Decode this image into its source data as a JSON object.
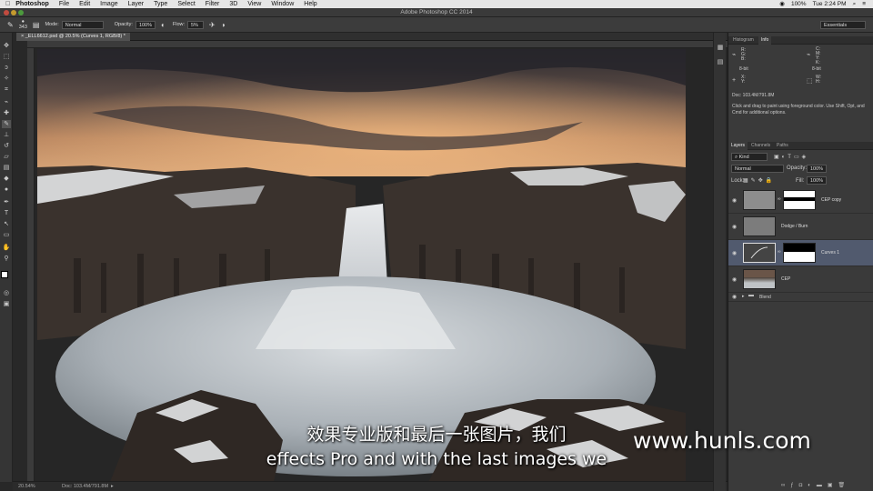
{
  "menubar": {
    "app": "Photoshop",
    "items": [
      "File",
      "Edit",
      "Image",
      "Layer",
      "Type",
      "Select",
      "Filter",
      "3D",
      "View",
      "Window",
      "Help"
    ],
    "battery": "100%",
    "clock": "Tue 2:24 PM"
  },
  "window_title": "Adobe Photoshop CC 2014",
  "options_bar": {
    "brush_size": "343",
    "mode_label": "Mode:",
    "mode_value": "Normal",
    "opacity_label": "Opacity:",
    "opacity_value": "100%",
    "flow_label": "Flow:",
    "flow_value": "5%",
    "workspace": "Essentials"
  },
  "document_tab": "_ELL6612.psd @ 20.5% (Curves 1, RGB/8) *",
  "statusbar": {
    "zoom": "20.54%",
    "doc": "Doc: 103.4M/791.8M"
  },
  "info_panel": {
    "tabs": [
      "Histogram",
      "Info"
    ],
    "rgb_labels": "R:\nG:\nB:",
    "cmyk_labels": "C:\nM:\nY:\nK:",
    "bit_left": "8-bit",
    "bit_right": "8-bit",
    "xy_labels": "X:\nY:",
    "wh_labels": "W:\nH:",
    "doc": "Doc: 103.4M/791.8M",
    "hint": "Click and drag to paint using foreground color.  Use Shift, Opt, and Cmd for additional options."
  },
  "layers_panel": {
    "tabs": [
      "Layers",
      "Channels",
      "Paths"
    ],
    "filter_kind": "Kind",
    "blend_mode": "Normal",
    "opacity_label": "Opacity:",
    "opacity_value": "100%",
    "lock_label": "Lock:",
    "fill_label": "Fill:",
    "fill_value": "100%",
    "layers": [
      {
        "name": "CEP copy"
      },
      {
        "name": "Dodge / Burn"
      },
      {
        "name": "Curves 1",
        "selected": true
      },
      {
        "name": "CEP"
      },
      {
        "name": "Blend",
        "group": true
      }
    ]
  },
  "subtitles": {
    "chinese": "效果专业版和最后一张图片，我们",
    "english": "effects Pro and with the last images we"
  },
  "watermark": "www.hunls.com",
  "colors": {
    "selected_layer": "#515a6e",
    "menubar": "#e6e6e6",
    "panel": "#3a3a3a"
  }
}
